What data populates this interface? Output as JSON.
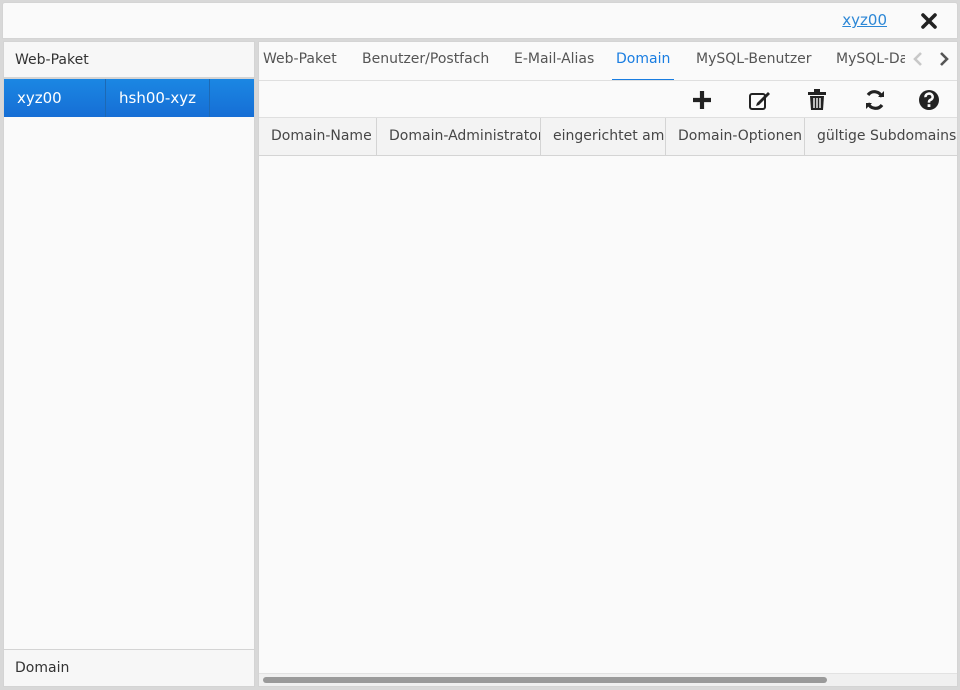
{
  "header": {
    "user": "xyz00",
    "close_icon": "close-icon"
  },
  "left": {
    "title": "Web-Paket",
    "rows": [
      {
        "name": "xyz00",
        "owner": "hsh00-xyz"
      }
    ],
    "footer": "Domain"
  },
  "tabs": [
    {
      "label": "Web-Paket",
      "selected": false
    },
    {
      "label": "Benutzer/Postfach",
      "selected": false
    },
    {
      "label": "E-Mail-Alias",
      "selected": false
    },
    {
      "label": "Domain",
      "selected": true
    },
    {
      "label": "MySQL-Benutzer",
      "selected": false
    },
    {
      "label": "MySQL-Da",
      "selected": false
    }
  ],
  "toolbar": {
    "icons": [
      "plus-icon",
      "edit-icon",
      "trash-icon",
      "refresh-icon",
      "help-icon"
    ]
  },
  "grid": {
    "columns": [
      "Domain-Name",
      "Domain-Administrator",
      "eingerichtet am",
      "Domain-Optionen",
      "gültige Subdomains (o"
    ]
  },
  "colors": {
    "accent": "#197de1",
    "link": "#2c87d6",
    "background": "#fafafa"
  }
}
